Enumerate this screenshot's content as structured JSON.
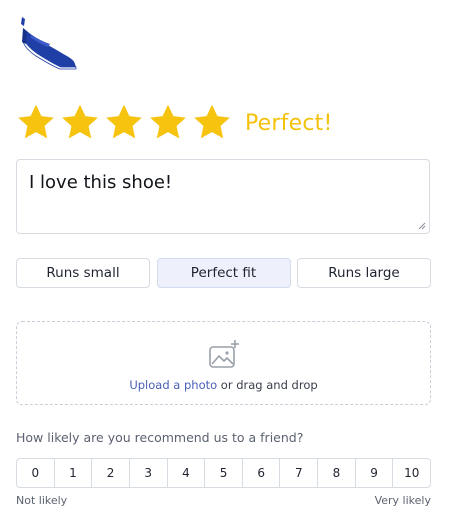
{
  "brand": {
    "logo_icon": "sneaker-icon",
    "logo_color": "#1f3fa6"
  },
  "rating": {
    "value": 5,
    "max": 5,
    "label": "Perfect!",
    "star_color": "#f6c40f"
  },
  "review": {
    "text": "I love this shoe!"
  },
  "fit_options": [
    {
      "label": "Runs small",
      "selected": false
    },
    {
      "label": "Perfect fit",
      "selected": true
    },
    {
      "label": "Runs large",
      "selected": false
    }
  ],
  "upload": {
    "icon": "add-image-icon",
    "link_text": "Upload a photo",
    "rest_text": " or drag and drop",
    "link_color": "#4a60b8"
  },
  "recommend": {
    "question": "How likely are you recommend us to a friend?",
    "scale": [
      "0",
      "1",
      "2",
      "3",
      "4",
      "5",
      "6",
      "7",
      "8",
      "9",
      "10"
    ],
    "min_label": "Not likely",
    "max_label": "Very likely"
  }
}
